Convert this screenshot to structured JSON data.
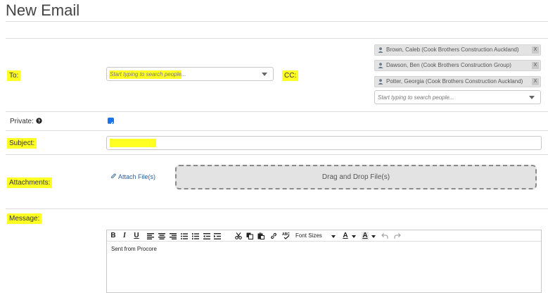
{
  "page": {
    "title": "New Email"
  },
  "form": {
    "to": {
      "label": "To:",
      "placeholder": "Start typing to search people..."
    },
    "cc": {
      "label": "CC:",
      "recipients": [
        "Brown, Caleb (Cook Brothers Construction Auckland)",
        "Dawson, Ben (Cook Brothers Construction Group)",
        "Potter, Georgia (Cook Brothers Construction Auckland)"
      ],
      "remove_label": "X",
      "placeholder": "Start typing to search people..."
    },
    "private": {
      "label": "Private:",
      "help_icon": "question-circle-icon",
      "checked": true
    },
    "subject": {
      "label": "Subject:",
      "value": ""
    },
    "attachments": {
      "label": "Attachments:",
      "attach_link": "Attach File(s)",
      "attach_icon": "paperclip-icon",
      "dropzone_text": "Drag and Drop File(s)"
    },
    "message": {
      "label": "Message:",
      "toolbar": {
        "bold": "B",
        "italic": "I",
        "underline": "U",
        "font_sizes": "Font Sizes",
        "font_color": "A",
        "highlight_color": "A",
        "icons": [
          "align-left-icon",
          "align-center-icon",
          "align-right-icon",
          "bullet-list-icon",
          "numbered-list-icon",
          "outdent-icon",
          "indent-icon",
          "cut-icon",
          "copy-icon",
          "paste-icon",
          "link-icon",
          "spellcheck-icon",
          "undo-icon",
          "redo-icon"
        ]
      },
      "body": "Sent from Procore"
    }
  },
  "colors": {
    "highlight": "#ffff24",
    "checkbox": "#1a73e8",
    "chip": "#e3e3e3"
  }
}
